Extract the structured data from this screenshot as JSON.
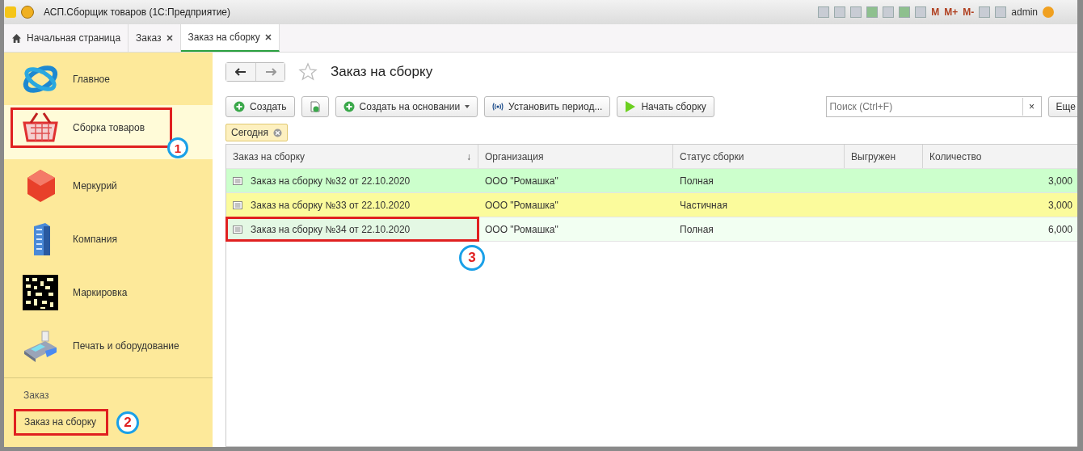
{
  "window": {
    "title": "АСП.Сборщик товаров  (1С:Предприятие)",
    "user": "admin",
    "toolbar_labels": [
      "M",
      "M+",
      "M-"
    ]
  },
  "tabs": [
    {
      "label": "Начальная страница",
      "kind": "home",
      "selected": false,
      "closable": false
    },
    {
      "label": "Заказ",
      "kind": "doc",
      "selected": false,
      "closable": true
    },
    {
      "label": "Заказ на сборку",
      "kind": "doc",
      "selected": true,
      "closable": true
    }
  ],
  "sidebar": {
    "sections": [
      {
        "label": "Главное",
        "kind": "globe",
        "selected": false,
        "highlighted": false
      },
      {
        "label": "Сборка товаров",
        "kind": "basket",
        "selected": true,
        "highlighted": true,
        "callout": "1"
      },
      {
        "label": "Меркурий",
        "kind": "cube",
        "selected": false,
        "highlighted": false
      },
      {
        "label": "Компания",
        "kind": "building",
        "selected": false,
        "highlighted": false
      },
      {
        "label": "Маркировка",
        "kind": "datamatrix",
        "selected": false,
        "highlighted": false
      },
      {
        "label": "Печать и оборудование",
        "kind": "terminal",
        "selected": false,
        "highlighted": false
      }
    ],
    "group_title": "Заказ",
    "links": [
      {
        "label": "Заказ на сборку",
        "highlighted": true,
        "callout": "2"
      }
    ]
  },
  "form": {
    "title": "Заказ на сборку",
    "buttons": [
      {
        "label": "Создать",
        "kind": "plus",
        "dropdown": false
      },
      {
        "kind": "copy",
        "dropdown": false
      },
      {
        "label": "Создать на основании",
        "kind": "plus",
        "dropdown": true
      },
      {
        "label": "Установить период...",
        "kind": "period",
        "dropdown": false
      },
      {
        "label": "Начать сборку",
        "kind": "play",
        "dropdown": false
      }
    ],
    "search": {
      "placeholder": "Поиск (Ctrl+F)",
      "clear": "×"
    },
    "more_button": "Еще",
    "filter_tag": "Сегодня",
    "table": {
      "columns": [
        {
          "label": "Заказ на сборку",
          "sort": "↓"
        },
        {
          "label": "Организация"
        },
        {
          "label": "Статус сборки"
        },
        {
          "label": "Выгружен"
        },
        {
          "label": "Количество"
        }
      ],
      "rows": [
        {
          "document": "Заказ на сборку №32 от 22.10.2020",
          "organization": "ООО \"Ромашка\"",
          "status": "Полная",
          "quantity": "3,000",
          "color": "#ccffcc",
          "selected": false,
          "highlighted": false
        },
        {
          "document": "Заказ на сборку №33 от 22.10.2020",
          "organization": "ООО \"Ромашка\"",
          "status": "Частичная",
          "quantity": "3,000",
          "color": "#fbfb9c",
          "selected": false,
          "highlighted": false
        },
        {
          "document": "Заказ на сборку №34 от 22.10.2020",
          "organization": "ООО \"Ромашка\"",
          "status": "Полная",
          "quantity": "6,000",
          "color": "#f2fff2",
          "selected": true,
          "highlighted": true,
          "callout": "3"
        }
      ]
    }
  }
}
